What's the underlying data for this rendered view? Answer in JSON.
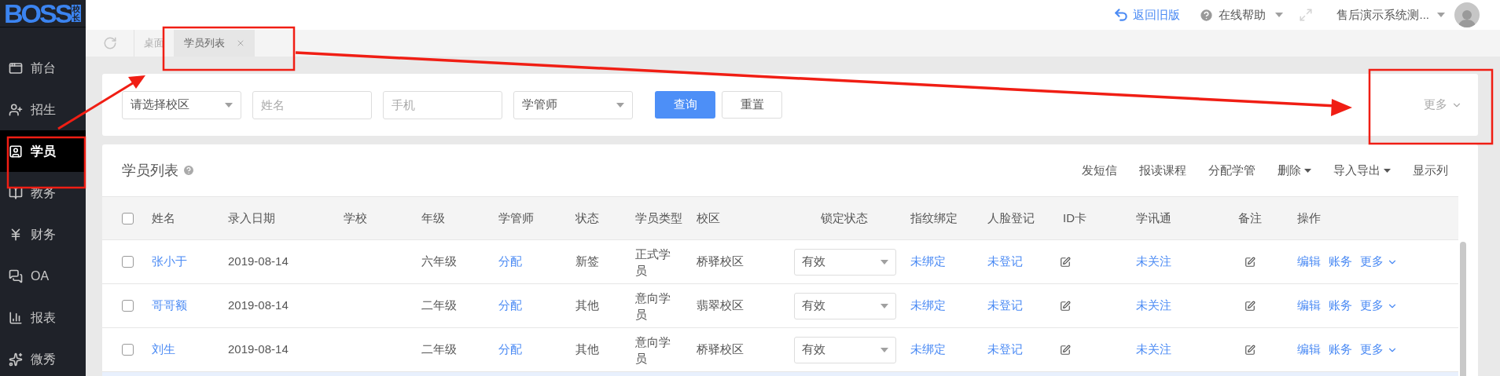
{
  "sidebar": {
    "logo": {
      "text": "BOSS",
      "badge": "校长"
    },
    "items": [
      {
        "label": "前台",
        "selected": false
      },
      {
        "label": "招生",
        "selected": false
      },
      {
        "label": "学员",
        "selected": true
      },
      {
        "label": "教务",
        "selected": false
      },
      {
        "label": "财务",
        "selected": false
      },
      {
        "label": "OA",
        "selected": false
      },
      {
        "label": "报表",
        "selected": false
      },
      {
        "label": "微秀",
        "selected": false
      }
    ]
  },
  "header": {
    "back_link": "返回旧版",
    "help": "在线帮助",
    "user": "售后演示系统测..."
  },
  "tabs": [
    {
      "label": "桌面",
      "selected": false,
      "closable": false
    },
    {
      "label": "学员列表",
      "selected": true,
      "closable": true
    }
  ],
  "filters": {
    "fields": [
      {
        "kind": "select",
        "placeholder": "请选择校区"
      },
      {
        "kind": "input",
        "placeholder": "姓名"
      },
      {
        "kind": "input",
        "placeholder": "手机"
      },
      {
        "kind": "select",
        "placeholder": "学管师"
      }
    ],
    "buttons": [
      {
        "label": "查询",
        "kind": "primary"
      },
      {
        "label": "重置",
        "kind": "default"
      }
    ],
    "more": "更多"
  },
  "list": {
    "title": "学员列表",
    "actions": [
      {
        "label": "发短信",
        "dropdown": false
      },
      {
        "label": "报读课程",
        "dropdown": false
      },
      {
        "label": "分配学管",
        "dropdown": false
      },
      {
        "label": "删除",
        "dropdown": true
      },
      {
        "label": "导入导出",
        "dropdown": true
      },
      {
        "label": "显示列",
        "dropdown": false
      }
    ],
    "select_all": {
      "checked": false
    },
    "columns": [
      "姓名",
      "录入日期",
      "学校",
      "年级",
      "学管师",
      "状态",
      "学员类型",
      "校区",
      "锁定状态",
      "指纹绑定",
      "人脸登记",
      "ID卡",
      "学讯通",
      "备注",
      "操作"
    ],
    "rows": [
      {
        "checked": false,
        "name": "张小于",
        "date": "2019-08-14",
        "grade": "六年级",
        "manager": "分配",
        "status": "新签",
        "type": "正式学员",
        "campus": "桥驿校区",
        "lock": "有效",
        "fingerprint": "未绑定",
        "face": "未登记",
        "wechat": "未关注",
        "actions": [
          "编辑",
          "账务",
          "更多"
        ]
      },
      {
        "checked": false,
        "name": "哥哥额",
        "date": "2019-08-14",
        "grade": "二年级",
        "manager": "分配",
        "status": "其他",
        "type": "意向学员",
        "campus": "翡翠校区",
        "lock": "有效",
        "fingerprint": "未绑定",
        "face": "未登记",
        "wechat": "未关注",
        "actions": [
          "编辑",
          "账务",
          "更多"
        ]
      },
      {
        "checked": false,
        "name": "刘生",
        "date": "2019-08-14",
        "grade": "二年级",
        "manager": "分配",
        "status": "其他",
        "type": "意向学员",
        "campus": "桥驿校区",
        "lock": "有效",
        "fingerprint": "未绑定",
        "face": "未登记",
        "wechat": "未关注",
        "actions": [
          "编辑",
          "账务",
          "更多"
        ]
      }
    ]
  }
}
